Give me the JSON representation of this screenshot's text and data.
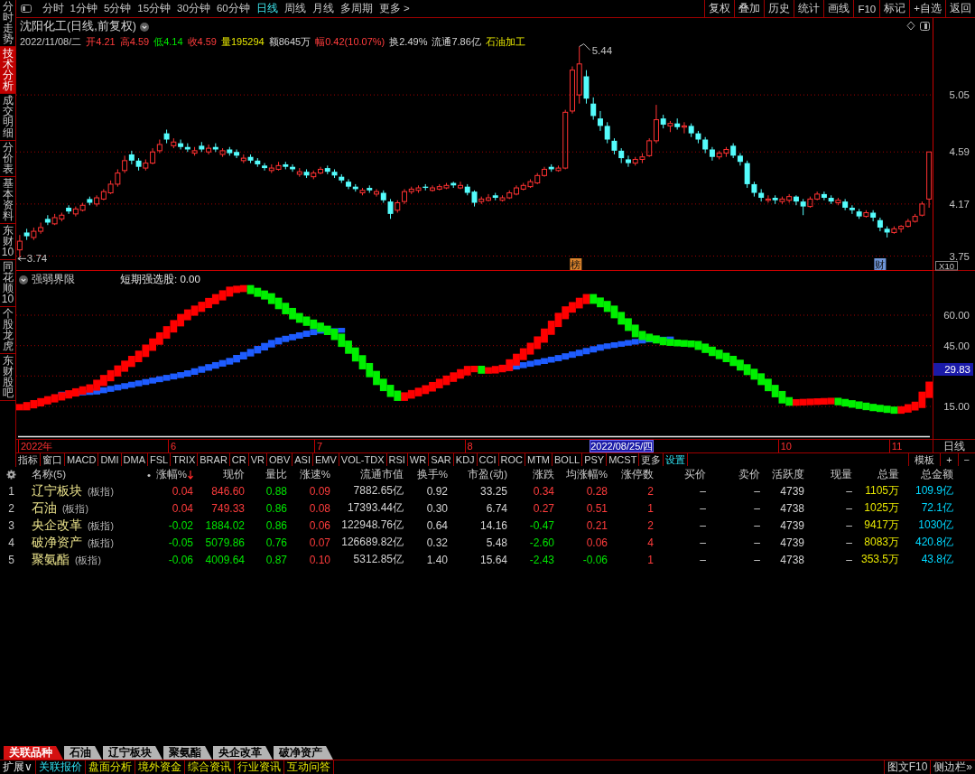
{
  "sidebar": {
    "items": [
      {
        "label": "分时走势",
        "selected": false
      },
      {
        "label": "技术分析",
        "selected": true
      },
      {
        "label": "成交明细",
        "selected": false
      },
      {
        "label": "分价表",
        "selected": false
      },
      {
        "label": "基本资料",
        "selected": false
      },
      {
        "label": "东财10",
        "selected": false
      },
      {
        "label": "同花顺10",
        "selected": false
      },
      {
        "label": "个股龙虎",
        "selected": false
      },
      {
        "label": "东财股吧",
        "selected": false
      }
    ]
  },
  "toolbar": {
    "periods": [
      {
        "label": "分时",
        "selected": false
      },
      {
        "label": "1分钟",
        "selected": false
      },
      {
        "label": "5分钟",
        "selected": false
      },
      {
        "label": "15分钟",
        "selected": false
      },
      {
        "label": "30分钟",
        "selected": false
      },
      {
        "label": "60分钟",
        "selected": false
      },
      {
        "label": "日线",
        "selected": true
      },
      {
        "label": "周线",
        "selected": false
      },
      {
        "label": "月线",
        "selected": false
      },
      {
        "label": "多周期",
        "selected": false
      },
      {
        "label": "更多 >",
        "selected": false
      }
    ],
    "buttons": [
      "复权",
      "叠加",
      "历史",
      "统计",
      "画线",
      "F10",
      "标记",
      "+自选",
      "返回"
    ]
  },
  "price_chart": {
    "title": "沈阳化工(日线,前复权)",
    "date": "2022/11/08/二",
    "fields": [
      {
        "text": "开4.21",
        "color": "#ff3c3c"
      },
      {
        "text": "高4.59",
        "color": "#ff3c3c"
      },
      {
        "text": "低4.14",
        "color": "#00e600"
      },
      {
        "text": "收4.59",
        "color": "#ff3c3c"
      },
      {
        "text": "量195294",
        "color": "#e6e600"
      },
      {
        "text": "额8645万"
      },
      {
        "text": "幅0.42(10.07%)",
        "color": "#ff3c3c"
      },
      {
        "text": "换2.49%"
      },
      {
        "text": "流通7.86亿"
      }
    ],
    "industry": "石油加工",
    "high_label": "5.44",
    "low_label": "3.74",
    "scale": "X10",
    "event_tags": [
      {
        "label": "榜",
        "color": "#d9822b"
      },
      {
        "label": "财",
        "color": "#6f96d8"
      }
    ],
    "chart_data": {
      "type": "candlestick",
      "grid": true,
      "ylim": [
        3.63,
        5.67
      ],
      "yticks": [
        {
          "value": 5.05,
          "label": "5.05"
        },
        {
          "value": 4.59,
          "label": "4.59"
        },
        {
          "value": 4.17,
          "label": "4.17"
        },
        {
          "value": 3.75,
          "label": "3.75"
        }
      ],
      "categories": [
        null,
        null,
        null,
        null,
        null,
        null,
        null,
        null,
        null,
        null,
        null,
        null,
        null,
        null,
        null,
        null,
        null,
        null,
        null,
        null,
        null,
        null,
        null,
        null,
        null,
        null,
        null,
        null,
        null,
        null,
        null,
        null,
        null,
        null,
        null,
        null,
        null,
        null,
        null,
        null,
        null,
        null,
        null,
        null,
        null,
        null,
        null,
        null,
        null,
        null,
        null,
        null,
        null,
        null,
        null,
        null,
        null,
        null,
        null,
        null,
        null,
        null,
        null,
        null,
        null,
        null,
        null,
        null,
        null,
        null,
        null,
        null,
        null,
        null,
        null,
        null,
        null,
        null,
        null,
        null,
        null,
        null,
        null,
        null,
        null,
        null,
        null,
        null,
        null,
        null,
        null,
        null,
        null,
        null,
        null,
        null,
        null,
        null,
        null,
        null,
        null,
        null,
        null,
        null,
        null,
        null,
        null,
        null,
        null,
        null,
        null,
        null,
        null,
        null,
        null,
        null,
        null,
        null,
        null,
        null,
        null,
        null,
        null,
        null,
        null,
        null,
        null,
        null,
        null,
        null,
        null
      ],
      "ohlc": [
        [
          3.8,
          3.92,
          3.74,
          3.87
        ],
        [
          3.94,
          3.97,
          3.88,
          3.91
        ],
        [
          3.9,
          3.98,
          3.88,
          3.95
        ],
        [
          3.95,
          4.02,
          3.93,
          3.98
        ],
        [
          4.05,
          4.08,
          4.0,
          4.02
        ],
        [
          4.01,
          4.09,
          4.0,
          4.06
        ],
        [
          4.05,
          4.1,
          4.03,
          4.08
        ],
        [
          4.14,
          4.16,
          4.09,
          4.11
        ],
        [
          4.09,
          4.15,
          4.07,
          4.13
        ],
        [
          4.12,
          4.18,
          4.11,
          4.16
        ],
        [
          4.21,
          4.23,
          4.16,
          4.18
        ],
        [
          4.17,
          4.24,
          4.15,
          4.22
        ],
        [
          4.21,
          4.29,
          4.2,
          4.27
        ],
        [
          4.26,
          4.36,
          4.25,
          4.33
        ],
        [
          4.33,
          4.45,
          4.31,
          4.42
        ],
        [
          4.44,
          4.56,
          4.42,
          4.52
        ],
        [
          4.57,
          4.6,
          4.49,
          4.52
        ],
        [
          4.52,
          4.54,
          4.44,
          4.47
        ],
        [
          4.46,
          4.53,
          4.44,
          4.5
        ],
        [
          4.5,
          4.62,
          4.49,
          4.59
        ],
        [
          4.6,
          4.69,
          4.58,
          4.65
        ],
        [
          4.74,
          4.77,
          4.66,
          4.69
        ],
        [
          4.64,
          4.7,
          4.62,
          4.67
        ],
        [
          4.66,
          4.69,
          4.61,
          4.63
        ],
        [
          4.63,
          4.66,
          4.59,
          4.61
        ],
        [
          4.58,
          4.63,
          4.56,
          4.6
        ],
        [
          4.64,
          4.67,
          4.59,
          4.61
        ],
        [
          4.59,
          4.65,
          4.57,
          4.62
        ],
        [
          4.63,
          4.66,
          4.59,
          4.61
        ],
        [
          4.57,
          4.62,
          4.55,
          4.6
        ],
        [
          4.61,
          4.63,
          4.56,
          4.58
        ],
        [
          4.59,
          4.61,
          4.54,
          4.56
        ],
        [
          4.52,
          4.57,
          4.5,
          4.54
        ],
        [
          4.55,
          4.57,
          4.5,
          4.52
        ],
        [
          4.52,
          4.54,
          4.47,
          4.49
        ],
        [
          4.48,
          4.5,
          4.44,
          4.46
        ],
        [
          4.44,
          4.49,
          4.42,
          4.46
        ],
        [
          4.45,
          4.51,
          4.44,
          4.48
        ],
        [
          4.49,
          4.51,
          4.45,
          4.47
        ],
        [
          4.47,
          4.49,
          4.43,
          4.45
        ],
        [
          4.41,
          4.46,
          4.39,
          4.43
        ],
        [
          4.43,
          4.45,
          4.38,
          4.4
        ],
        [
          4.39,
          4.44,
          4.37,
          4.42
        ],
        [
          4.42,
          4.47,
          4.41,
          4.45
        ],
        [
          4.46,
          4.48,
          4.41,
          4.43
        ],
        [
          4.43,
          4.45,
          4.38,
          4.4
        ],
        [
          4.39,
          4.41,
          4.34,
          4.36
        ],
        [
          4.35,
          4.37,
          4.29,
          4.31
        ],
        [
          4.31,
          4.33,
          4.27,
          4.29
        ],
        [
          4.26,
          4.3,
          4.24,
          4.28
        ],
        [
          4.3,
          4.32,
          4.26,
          4.28
        ],
        [
          4.25,
          4.29,
          4.23,
          4.27
        ],
        [
          4.26,
          4.28,
          4.18,
          4.2
        ],
        [
          4.19,
          4.21,
          4.05,
          4.09
        ],
        [
          4.12,
          4.2,
          4.1,
          4.18
        ],
        [
          4.19,
          4.29,
          4.17,
          4.27
        ],
        [
          4.27,
          4.31,
          4.25,
          4.29
        ],
        [
          4.28,
          4.32,
          4.26,
          4.3
        ],
        [
          4.31,
          4.33,
          4.28,
          4.3
        ],
        [
          4.28,
          4.32,
          4.27,
          4.3
        ],
        [
          4.29,
          4.33,
          4.28,
          4.31
        ],
        [
          4.3,
          4.34,
          4.29,
          4.32
        ],
        [
          4.34,
          4.35,
          4.3,
          4.32
        ],
        [
          4.3,
          4.35,
          4.29,
          4.32
        ],
        [
          4.31,
          4.33,
          4.24,
          4.26
        ],
        [
          4.27,
          4.28,
          4.15,
          4.18
        ],
        [
          4.19,
          4.23,
          4.17,
          4.21
        ],
        [
          4.2,
          4.25,
          4.19,
          4.22
        ],
        [
          4.24,
          4.26,
          4.2,
          4.22
        ],
        [
          4.2,
          4.24,
          4.19,
          4.22
        ],
        [
          4.22,
          4.28,
          4.21,
          4.26
        ],
        [
          4.25,
          4.32,
          4.24,
          4.3
        ],
        [
          4.29,
          4.34,
          4.28,
          4.32
        ],
        [
          4.31,
          4.37,
          4.3,
          4.35
        ],
        [
          4.34,
          4.42,
          4.33,
          4.4
        ],
        [
          4.4,
          4.47,
          4.39,
          4.45
        ],
        [
          4.47,
          4.49,
          4.43,
          4.45
        ],
        [
          4.44,
          4.48,
          4.43,
          4.46
        ],
        [
          4.46,
          4.93,
          4.45,
          4.91
        ],
        [
          4.92,
          5.28,
          4.9,
          5.25
        ],
        [
          5.05,
          5.44,
          4.98,
          5.3
        ],
        [
          5.2,
          5.25,
          4.98,
          5.02
        ],
        [
          4.98,
          5.03,
          4.85,
          4.88
        ],
        [
          4.86,
          4.92,
          4.76,
          4.8
        ],
        [
          4.8,
          4.83,
          4.66,
          4.69
        ],
        [
          4.68,
          4.7,
          4.57,
          4.6
        ],
        [
          4.6,
          4.62,
          4.5,
          4.54
        ],
        [
          4.53,
          4.56,
          4.47,
          4.5
        ],
        [
          4.5,
          4.55,
          4.48,
          4.53
        ],
        [
          4.53,
          4.58,
          4.5,
          4.55
        ],
        [
          4.56,
          4.7,
          4.55,
          4.68
        ],
        [
          4.68,
          4.97,
          4.66,
          4.85
        ],
        [
          4.86,
          4.89,
          4.78,
          4.81
        ],
        [
          4.8,
          4.84,
          4.75,
          4.82
        ],
        [
          4.82,
          4.86,
          4.77,
          4.79
        ],
        [
          4.79,
          4.83,
          4.74,
          4.8
        ],
        [
          4.8,
          4.82,
          4.71,
          4.74
        ],
        [
          4.74,
          4.76,
          4.66,
          4.69
        ],
        [
          4.69,
          4.71,
          4.58,
          4.61
        ],
        [
          4.61,
          4.63,
          4.52,
          4.55
        ],
        [
          4.55,
          4.6,
          4.53,
          4.58
        ],
        [
          4.58,
          4.63,
          4.55,
          4.61
        ],
        [
          4.64,
          4.66,
          4.54,
          4.56
        ],
        [
          4.56,
          4.58,
          4.48,
          4.51
        ],
        [
          4.5,
          4.52,
          4.3,
          4.33
        ],
        [
          4.33,
          4.35,
          4.23,
          4.26
        ],
        [
          4.26,
          4.29,
          4.19,
          4.22
        ],
        [
          4.2,
          4.24,
          4.18,
          4.21
        ],
        [
          4.22,
          4.24,
          4.17,
          4.2
        ],
        [
          4.19,
          4.23,
          4.17,
          4.21
        ],
        [
          4.2,
          4.25,
          4.18,
          4.23
        ],
        [
          4.23,
          4.24,
          4.16,
          4.19
        ],
        [
          4.19,
          4.21,
          4.08,
          4.15
        ],
        [
          4.15,
          4.23,
          4.14,
          4.21
        ],
        [
          4.21,
          4.27,
          4.2,
          4.25
        ],
        [
          4.25,
          4.27,
          4.2,
          4.22
        ],
        [
          4.22,
          4.24,
          4.17,
          4.19
        ],
        [
          4.18,
          4.22,
          4.16,
          4.2
        ],
        [
          4.19,
          4.21,
          4.12,
          4.14
        ],
        [
          4.14,
          4.16,
          4.09,
          4.12
        ],
        [
          4.11,
          4.13,
          4.05,
          4.07
        ],
        [
          4.07,
          4.12,
          4.06,
          4.1
        ],
        [
          4.1,
          4.12,
          4.03,
          4.06
        ],
        [
          4.04,
          4.06,
          3.95,
          3.98
        ],
        [
          3.97,
          3.99,
          3.9,
          3.94
        ],
        [
          3.94,
          3.99,
          3.93,
          3.97
        ],
        [
          3.97,
          4.0,
          3.94,
          3.99
        ],
        [
          3.99,
          4.05,
          3.98,
          4.03
        ],
        [
          4.03,
          4.09,
          4.02,
          4.07
        ],
        [
          4.08,
          4.19,
          4.07,
          4.17
        ],
        [
          4.21,
          4.59,
          4.14,
          4.59
        ]
      ]
    }
  },
  "indicator": {
    "name": "强弱界限",
    "readout": "短期强选股: 0.00",
    "y_ticks": [
      "60.00",
      "45.00",
      "15.00"
    ],
    "current_value": "29.83"
  },
  "time_axis": {
    "labels": [
      "2022年",
      "6",
      "7",
      "8",
      "10",
      "11"
    ],
    "cursor_label": "2022/08/25/四",
    "period": "日线"
  },
  "indicator_tabs": {
    "items": [
      "指标",
      "窗口",
      "MACD",
      "DMI",
      "DMA",
      "FSL",
      "TRIX",
      "BRAR",
      "CR",
      "VR",
      "OBV",
      "ASI",
      "EMV",
      "VOL-TDX",
      "RSI",
      "WR",
      "SAR",
      "KDJ",
      "CCI",
      "ROC",
      "MTM",
      "BOLL",
      "PSY",
      "MCST",
      "更多"
    ],
    "settings": "设置",
    "right": [
      "模板",
      "+",
      "−"
    ]
  },
  "table": {
    "name_header": "名称(5)",
    "marker_header": "•",
    "columns": [
      {
        "label": "涨幅%",
        "sorted": true
      },
      {
        "label": "现价",
        "sorted": false
      },
      {
        "label": "量比",
        "sorted": false
      },
      {
        "label": "涨速%",
        "sorted": false
      },
      {
        "label": "流通市值",
        "sorted": false
      },
      {
        "label": "换手%",
        "sorted": false
      },
      {
        "label": "市盈(动)",
        "sorted": false
      },
      {
        "label": "涨跌",
        "sorted": false
      },
      {
        "label": "均涨幅%",
        "sorted": false
      },
      {
        "label": "涨停数",
        "sorted": false
      },
      {
        "label": "买价",
        "sorted": false
      },
      {
        "label": "卖价",
        "sorted": false
      },
      {
        "label": "活跃度",
        "sorted": false
      },
      {
        "label": "现量",
        "sorted": false
      },
      {
        "label": "总量",
        "sorted": false
      },
      {
        "label": "总金额",
        "sorted": false
      }
    ],
    "rows": [
      {
        "index": "1",
        "name": "辽宁板块",
        "tag": "(板指)",
        "cells": [
          {
            "text": "0.04",
            "color": "#ff3c3c"
          },
          {
            "text": "846.60",
            "color": "#ff3c3c"
          },
          {
            "text": "0.88",
            "color": "#00e600"
          },
          {
            "text": "0.09",
            "color": "#ff3c3c"
          },
          {
            "text": "7882.65亿"
          },
          {
            "text": "0.92"
          },
          {
            "text": "33.25"
          },
          {
            "text": "0.34",
            "color": "#ff3c3c"
          },
          {
            "text": "0.28",
            "color": "#ff3c3c"
          },
          {
            "text": "2",
            "color": "#ff3c3c"
          },
          {
            "text": "–"
          },
          {
            "text": "–"
          },
          {
            "text": "4739"
          },
          {
            "text": "–"
          },
          {
            "text": "1105万",
            "color": "#e6e600"
          },
          {
            "text": "109.9亿",
            "color": "#00d8ff"
          }
        ]
      },
      {
        "index": "2",
        "name": "石油",
        "tag": "(板指)",
        "cells": [
          {
            "text": "0.04",
            "color": "#ff3c3c"
          },
          {
            "text": "749.33",
            "color": "#ff3c3c"
          },
          {
            "text": "0.86",
            "color": "#00e600"
          },
          {
            "text": "0.08",
            "color": "#ff3c3c"
          },
          {
            "text": "17393.44亿"
          },
          {
            "text": "0.30"
          },
          {
            "text": "6.74"
          },
          {
            "text": "0.27",
            "color": "#ff3c3c"
          },
          {
            "text": "0.51",
            "color": "#ff3c3c"
          },
          {
            "text": "1",
            "color": "#ff3c3c"
          },
          {
            "text": "–"
          },
          {
            "text": "–"
          },
          {
            "text": "4738"
          },
          {
            "text": "–"
          },
          {
            "text": "1025万",
            "color": "#e6e600"
          },
          {
            "text": "72.1亿",
            "color": "#00d8ff"
          }
        ]
      },
      {
        "index": "3",
        "name": "央企改革",
        "tag": "(板指)",
        "cells": [
          {
            "text": "-0.02",
            "color": "#00e600"
          },
          {
            "text": "1884.02",
            "color": "#00e600"
          },
          {
            "text": "0.86",
            "color": "#00e600"
          },
          {
            "text": "0.06",
            "color": "#ff3c3c"
          },
          {
            "text": "122948.76亿"
          },
          {
            "text": "0.64"
          },
          {
            "text": "14.16"
          },
          {
            "text": "-0.47",
            "color": "#00e600"
          },
          {
            "text": "0.21",
            "color": "#ff3c3c"
          },
          {
            "text": "2",
            "color": "#ff3c3c"
          },
          {
            "text": "–"
          },
          {
            "text": "–"
          },
          {
            "text": "4739"
          },
          {
            "text": "–"
          },
          {
            "text": "9417万",
            "color": "#e6e600"
          },
          {
            "text": "1030亿",
            "color": "#00d8ff"
          }
        ]
      },
      {
        "index": "4",
        "name": "破净资产",
        "tag": "(板指)",
        "cells": [
          {
            "text": "-0.05",
            "color": "#00e600"
          },
          {
            "text": "5079.86",
            "color": "#00e600"
          },
          {
            "text": "0.76",
            "color": "#00e600"
          },
          {
            "text": "0.07",
            "color": "#ff3c3c"
          },
          {
            "text": "126689.82亿"
          },
          {
            "text": "0.32"
          },
          {
            "text": "5.48"
          },
          {
            "text": "-2.60",
            "color": "#00e600"
          },
          {
            "text": "0.06",
            "color": "#ff3c3c"
          },
          {
            "text": "4",
            "color": "#ff3c3c"
          },
          {
            "text": "–"
          },
          {
            "text": "–"
          },
          {
            "text": "4739"
          },
          {
            "text": "–"
          },
          {
            "text": "8083万",
            "color": "#e6e600"
          },
          {
            "text": "420.8亿",
            "color": "#00d8ff"
          }
        ]
      },
      {
        "index": "5",
        "name": "聚氨酯",
        "tag": "(板指)",
        "cells": [
          {
            "text": "-0.06",
            "color": "#00e600"
          },
          {
            "text": "4009.64",
            "color": "#00e600"
          },
          {
            "text": "0.87",
            "color": "#00e600"
          },
          {
            "text": "0.10",
            "color": "#ff3c3c"
          },
          {
            "text": "5312.85亿"
          },
          {
            "text": "1.40"
          },
          {
            "text": "15.64"
          },
          {
            "text": "-2.43",
            "color": "#00e600"
          },
          {
            "text": "-0.06",
            "color": "#00e600"
          },
          {
            "text": "1",
            "color": "#ff3c3c"
          },
          {
            "text": "–"
          },
          {
            "text": "–"
          },
          {
            "text": "4738"
          },
          {
            "text": "–"
          },
          {
            "text": "353.5万",
            "color": "#e6e600"
          },
          {
            "text": "43.8亿",
            "color": "#00d8ff"
          }
        ]
      }
    ]
  },
  "bottom_tabs": [
    {
      "label": "关联品种",
      "selected": true
    },
    {
      "label": "石油",
      "selected": false
    },
    {
      "label": "辽宁板块",
      "selected": false
    },
    {
      "label": "聚氨酯",
      "selected": false
    },
    {
      "label": "央企改革",
      "selected": false
    },
    {
      "label": "破净资产",
      "selected": false
    }
  ],
  "status_bar": {
    "expand": "扩展∨",
    "items": [
      {
        "label": "关联报价",
        "selected": true
      },
      {
        "label": "盘面分析",
        "selected": false
      },
      {
        "label": "境外资金",
        "selected": false
      },
      {
        "label": "综合资讯",
        "selected": false
      },
      {
        "label": "行业资讯",
        "selected": false
      },
      {
        "label": "互动问答",
        "selected": false
      }
    ],
    "right": [
      "图文F10",
      "侧边栏»"
    ]
  }
}
